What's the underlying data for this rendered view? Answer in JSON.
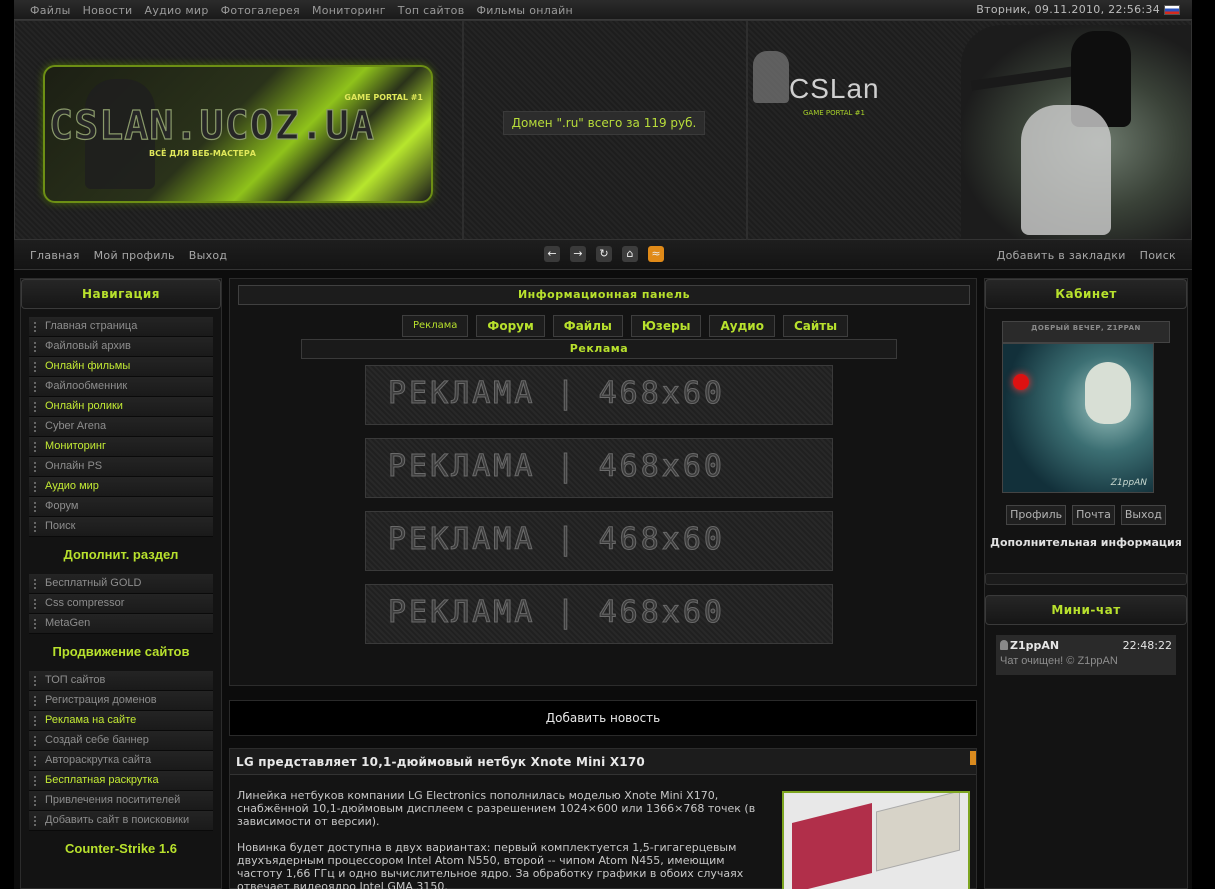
{
  "topbar": {
    "menu": [
      "Файлы",
      "Новости",
      "Аудио мир",
      "Фотогалерея",
      "Мониторинг",
      "Топ сайтов",
      "Фильмы онлайн"
    ],
    "datetime": "Вторник, 09.11.2010, 22:56:34"
  },
  "header": {
    "logo_title": "CSLAN.UCOZ.UA",
    "logo_tag": "GAME PORTAL #1",
    "logo_sub": "ВСЁ ДЛЯ ВЕБ-МАСТЕРА",
    "domain_ad": "Домен \".ru\" всего за 119 руб.",
    "brand": "CSLan",
    "brand_sub": "GAME PORTAL #1"
  },
  "navbar": {
    "left": [
      "Главная",
      "Мой профиль",
      "Выход"
    ],
    "icons": [
      "arrow-left-icon",
      "arrow-right-icon",
      "refresh-icon",
      "home-icon",
      "rss-icon"
    ],
    "right": [
      "Добавить в закладки",
      "Поиск"
    ]
  },
  "left": {
    "nav_title": "Навигация",
    "nav_items": [
      {
        "label": "Главная страница",
        "hl": false
      },
      {
        "label": "Файловый архив",
        "hl": false
      },
      {
        "label": "Онлайн фильмы",
        "hl": true
      },
      {
        "label": "Файлообменник",
        "hl": false
      },
      {
        "label": "Онлайн ролики",
        "hl": true
      },
      {
        "label": "Cyber Arena",
        "hl": false
      },
      {
        "label": "Мониторинг",
        "hl": true
      },
      {
        "label": "Онлайн PS",
        "hl": false
      },
      {
        "label": "Аудио мир",
        "hl": true
      },
      {
        "label": "Форум",
        "hl": false
      },
      {
        "label": "Поиск",
        "hl": false
      }
    ],
    "extra_title": "Дополнит. раздел",
    "extra_items": [
      "Бесплатный GOLD",
      "Css compressor",
      "MetaGen"
    ],
    "promo_title": "Продвижение сайтов",
    "promo_items": [
      {
        "label": "ТОП сайтов",
        "hl": false
      },
      {
        "label": "Регистрация доменов",
        "hl": false
      },
      {
        "label": "Реклама на сайте",
        "hl": true
      },
      {
        "label": "Создай себе баннер",
        "hl": false
      },
      {
        "label": "Автораскрутка сайта",
        "hl": false
      },
      {
        "label": "Бесплатная раскрутка",
        "hl": true
      },
      {
        "label": "Привлечения поситителей",
        "hl": false
      },
      {
        "label": "Добавить сайт в поисковики",
        "hl": false
      }
    ],
    "cs_title": "Counter-Strike 1.6"
  },
  "center": {
    "info_title": "Информационная панель",
    "tabs": [
      "Реклама",
      "Форум",
      "Файлы",
      "Юзеры",
      "Аудио",
      "Сайты"
    ],
    "ad_title": "Реклама",
    "banner_text": "РЕКЛАМА | 468x60",
    "banner_count": 4,
    "add_news": "Добавить новость"
  },
  "news": {
    "title": "LG представляет 10,1-дюймовый нетбук Xnote Mini X170",
    "paragraphs": [
      "Линейка нетбуков компании LG Electronics пополнилась моделью Xnote Mini X170, снабжённой 10,1-дюймовым дисплеем с разрешением 1024×600 или 1366×768 точек (в зависимости от версии).",
      "Новинка будет доступна в двух вариантах: первый комплектуется 1,5-гигагерцевым двухъядерным процессором Intel Atom N550, второй -- чипом Atom N455, имеющим частоту 1,66 ГГц и одно вычислительное ядро. За обработку графики в обоих случаях отвечает видеоядро Intel GMA 3150."
    ]
  },
  "right": {
    "cab_title": "Кабинет",
    "greeting": "ДОБРЫЙ ВЕЧЕР, Z1PPAN",
    "avatar_sig": "Z1ppAN",
    "buttons": [
      "Профиль",
      "Почта",
      "Выход"
    ],
    "addinfo": "Дополнительная информация",
    "chat_title": "Мини-чат",
    "chat": {
      "user": "Z1ppAN",
      "time": "22:48:22",
      "message": "Чат очищен! © Z1ppAN"
    }
  },
  "colors": {
    "accent": "#b8e12d",
    "background": "#131313"
  }
}
